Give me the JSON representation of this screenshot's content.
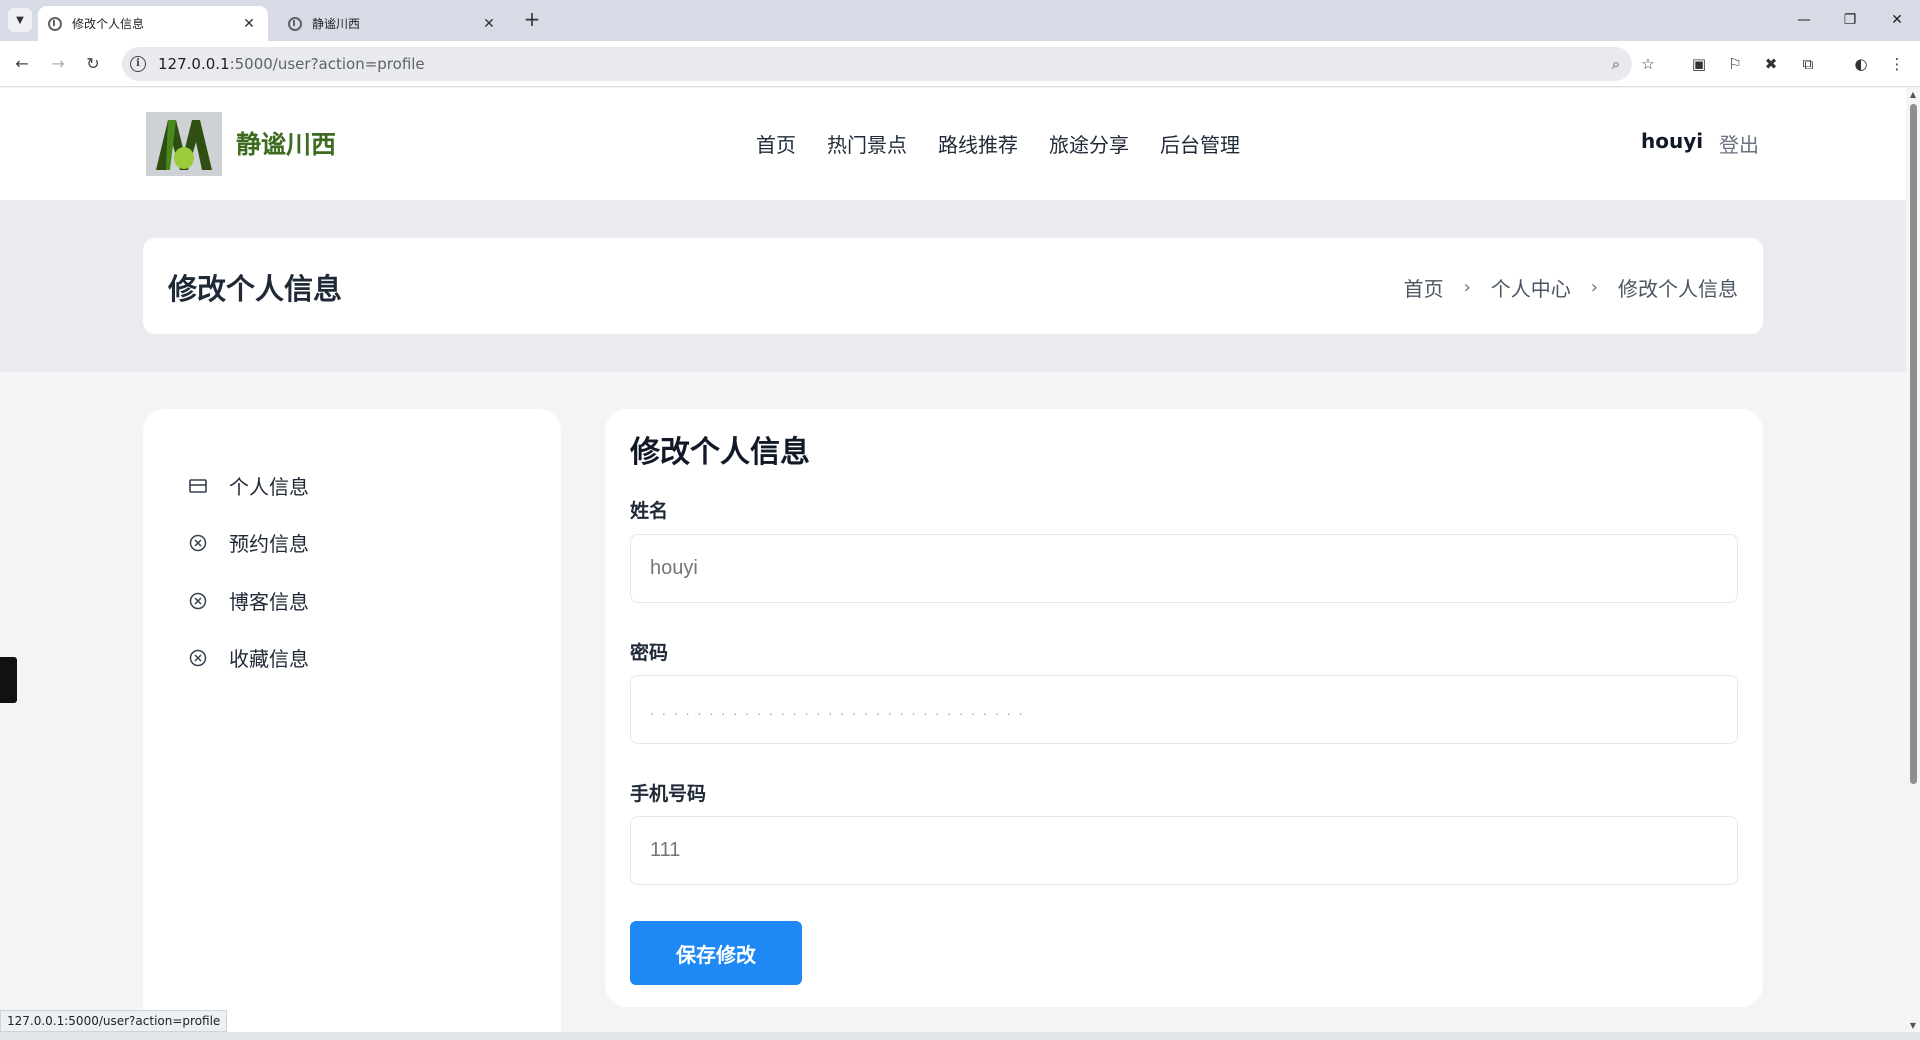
{
  "browser": {
    "tabs": [
      {
        "title": "修改个人信息",
        "active": true
      },
      {
        "title": "静谧川西",
        "active": false
      }
    ],
    "url_host": "127.0.0.1",
    "url_path": ":5000/user?action=profile",
    "status_url": "127.0.0.1:5000/user?action=profile"
  },
  "site": {
    "name": "静谧川西",
    "nav": [
      "首页",
      "热门景点",
      "路线推荐",
      "旅途分享",
      "后台管理"
    ],
    "username": "houyi",
    "logout": "登出",
    "brand_color": "#3d6b1f"
  },
  "page": {
    "title": "修改个人信息",
    "breadcrumb": [
      "首页",
      "个人中心",
      "修改个人信息"
    ]
  },
  "sidebar": {
    "items": [
      {
        "label": "个人信息",
        "icon": "id-card-icon"
      },
      {
        "label": "预约信息",
        "icon": "circle-x-icon"
      },
      {
        "label": "博客信息",
        "icon": "circle-x-icon"
      },
      {
        "label": "收藏信息",
        "icon": "circle-x-icon"
      }
    ]
  },
  "form": {
    "heading": "修改个人信息",
    "name_label": "姓名",
    "name_placeholder": "houyi",
    "password_label": "密码",
    "password_value": "................................",
    "phone_label": "手机号码",
    "phone_placeholder": "111",
    "save_label": "保存修改",
    "accent_color": "#1e88f5"
  }
}
